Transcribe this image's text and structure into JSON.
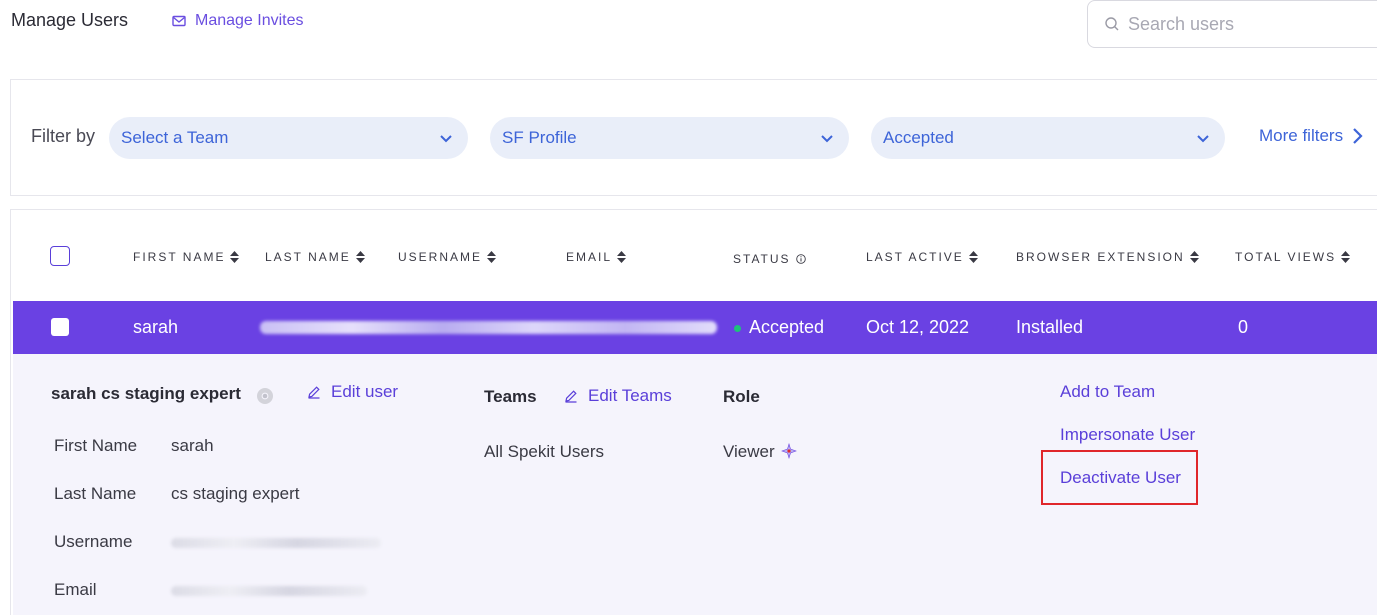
{
  "header": {
    "title": "Manage Users",
    "invites_label": "Manage Invites",
    "search_placeholder": "Search users"
  },
  "filters": {
    "label": "Filter by",
    "team": "Select a Team",
    "profile": "SF Profile",
    "status": "Accepted",
    "more": "More filters"
  },
  "table": {
    "columns": [
      "FIRST NAME",
      "LAST NAME",
      "USERNAME",
      "EMAIL",
      "STATUS",
      "LAST ACTIVE",
      "BROWSER EXTENSION",
      "TOTAL VIEWS"
    ],
    "row": {
      "first_name": "sarah",
      "status": "Accepted",
      "last_active": "Oct 12, 2022",
      "browser_extension": "Installed",
      "total_views": "0"
    }
  },
  "detail": {
    "full_name": "sarah cs staging expert",
    "edit_user": "Edit user",
    "fields": [
      {
        "label": "First Name",
        "value": "sarah"
      },
      {
        "label": "Last Name",
        "value": "cs staging expert"
      },
      {
        "label": "Username",
        "value": ""
      },
      {
        "label": "Email",
        "value": ""
      }
    ],
    "teams_heading": "Teams",
    "edit_teams": "Edit Teams",
    "team_name": "All Spekit Users",
    "role_heading": "Role",
    "role_value": "Viewer",
    "actions": [
      "Add to Team",
      "Impersonate User",
      "Deactivate User"
    ]
  },
  "colors": {
    "accent": "#6a41e3",
    "link": "#5a3fd9",
    "filter_text": "#3d64d8",
    "status_green": "#1ec27a",
    "highlight_red": "#e0262b"
  }
}
